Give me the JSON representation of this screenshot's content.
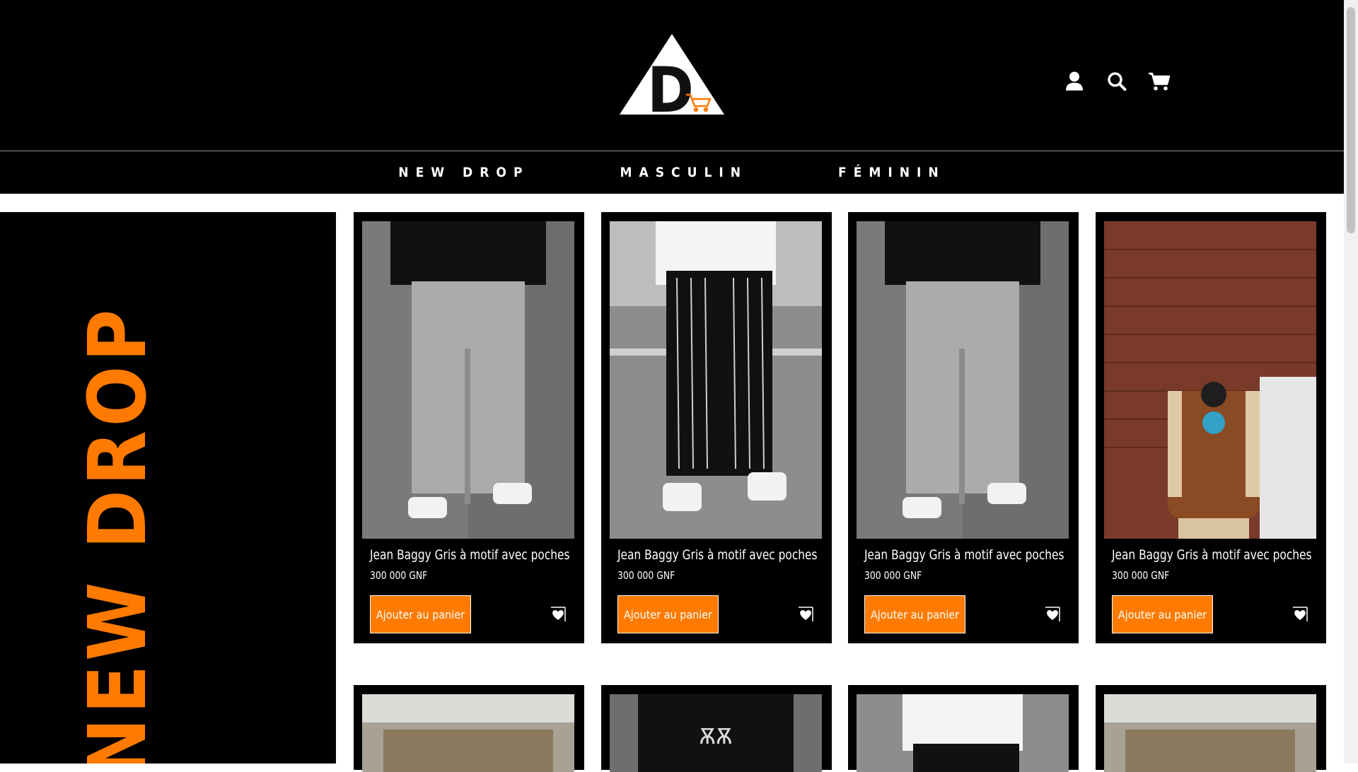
{
  "logo": {
    "letter": "D"
  },
  "header_icons": [
    "user-icon",
    "search-icon",
    "cart-icon"
  ],
  "nav": [
    {
      "label": "NEW DROP"
    },
    {
      "label": "MASCULIN"
    },
    {
      "label": "FÉMININ"
    }
  ],
  "banner": {
    "text": "NEW DROP",
    "text_color": "#ff7a00"
  },
  "products": [
    {
      "title": "Jean Baggy Gris à motif avec poches",
      "price": "300 000 GNF",
      "button": "Ajouter au panier",
      "photo": "grey-cargo-jeans"
    },
    {
      "title": "Jean Baggy Gris à motif avec poches",
      "price": "300 000 GNF",
      "button": "Ajouter au panier",
      "photo": "black-striped-pants"
    },
    {
      "title": "Jean Baggy Gris à motif avec poches",
      "price": "300 000 GNF",
      "button": "Ajouter au panier",
      "photo": "grey-cargo-jeans"
    },
    {
      "title": "Jean Baggy Gris à motif avec poches",
      "price": "300 000 GNF",
      "button": "Ajouter au panier",
      "photo": "brown-varsity-jacket"
    }
  ],
  "colors": {
    "accent": "#ff7a00",
    "background": "#000000"
  }
}
